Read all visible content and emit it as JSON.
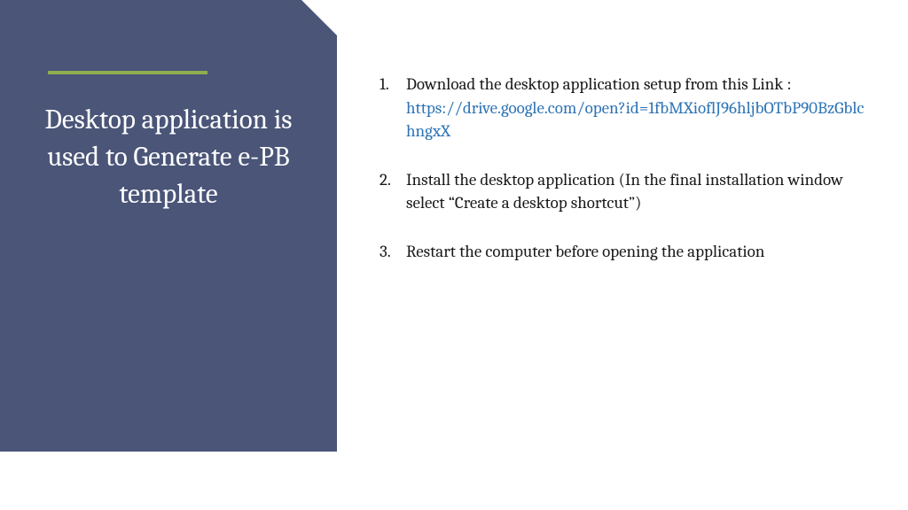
{
  "title": "Desktop application is used to Generate e-PB template",
  "items": [
    {
      "text": "Download the desktop application setup from this Link :",
      "link": "https://drive.google.com/open?id=1fbMXioflJ96hljbOTbP90BzGblchngxX"
    },
    {
      "text": "Install the desktop application (In the final installation window select “Create a desktop shortcut”)"
    },
    {
      "text": "Restart the computer before opening the application"
    }
  ]
}
